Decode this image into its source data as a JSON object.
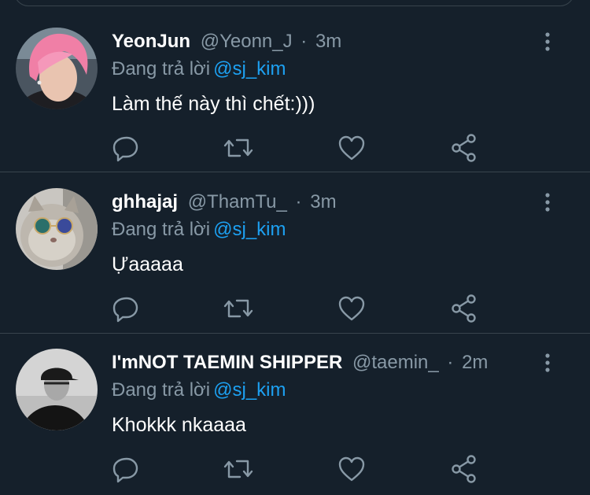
{
  "colors": {
    "background": "#15202b",
    "border": "#38444d",
    "muted_text": "#8899a6",
    "mention": "#1da1f2",
    "primary_text": "#ffffff"
  },
  "reply_prefix": "Đang trả lời",
  "tweets": [
    {
      "name": "YeonJun",
      "handle": "@Yeonn_J",
      "separator": "·",
      "time": "3m",
      "reply_to": "@sj_kim",
      "text": "Làm thế này thì chết:)))",
      "avatar_icon": "pink-hair-person-avatar"
    },
    {
      "name": "ghhajaj",
      "handle": "@ThamTu_",
      "separator": "·",
      "time": "3m",
      "reply_to": "@sj_kim",
      "text": "Ựaaaaa",
      "avatar_icon": "cat-with-sunglasses-avatar"
    },
    {
      "name": "I'mNOT TAEMIN SHIPPER",
      "handle": "@taemin_",
      "separator": "·",
      "time": "2m",
      "reply_to": "@sj_kim",
      "text": "Khokkk nkaaaa",
      "avatar_icon": "person-in-cap-avatar"
    }
  ],
  "action_icons": [
    "reply-icon",
    "retweet-icon",
    "like-icon",
    "share-icon"
  ],
  "more_icon": "more-options-icon"
}
